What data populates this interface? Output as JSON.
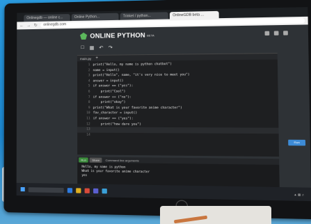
{
  "browser": {
    "tabs": [
      {
        "label": "Onlinegdb — online c...",
        "active": false
      },
      {
        "label": "Online Python...",
        "active": false
      },
      {
        "label": "Trinket / python...",
        "active": false
      },
      {
        "label": "OnlineGDB beta ...",
        "active": true
      }
    ],
    "url": "onlinegdb.com"
  },
  "app": {
    "title": "ONLINE PYTHON",
    "badge": "BETA",
    "accent": "#5cb85c"
  },
  "toolbar": {
    "icons": [
      "new-file-icon",
      "save-icon",
      "undo-icon",
      "redo-icon"
    ]
  },
  "editor": {
    "file_tab": "main.py",
    "code": [
      "print(\"Hello, my name is python chatbot\")",
      "name = input()",
      "print(\"Hello\", name, \"it's very nice to meet you\")",
      "answer = input()",
      "if answer == (\"yes\"):",
      "    print(\"Cool\")",
      "if answer == (\"no\"):",
      "    print(\"okay\")",
      "print(\"What is your favorite anime character\")",
      "fav_character = input()",
      "if answer == (\"yes\"):",
      "    print(\"how dare you\")",
      "",
      ""
    ],
    "run_label": "Run"
  },
  "console": {
    "tabs": [
      "Run",
      "Share",
      "Command line arguments"
    ],
    "output": [
      "Hello, my name is python",
      "What is your favorite anime character",
      "yes"
    ]
  },
  "colors": {
    "editor_bg": "#1e1f21",
    "console_bg": "#1a1b1d",
    "run_button": "#3d8bd6"
  }
}
